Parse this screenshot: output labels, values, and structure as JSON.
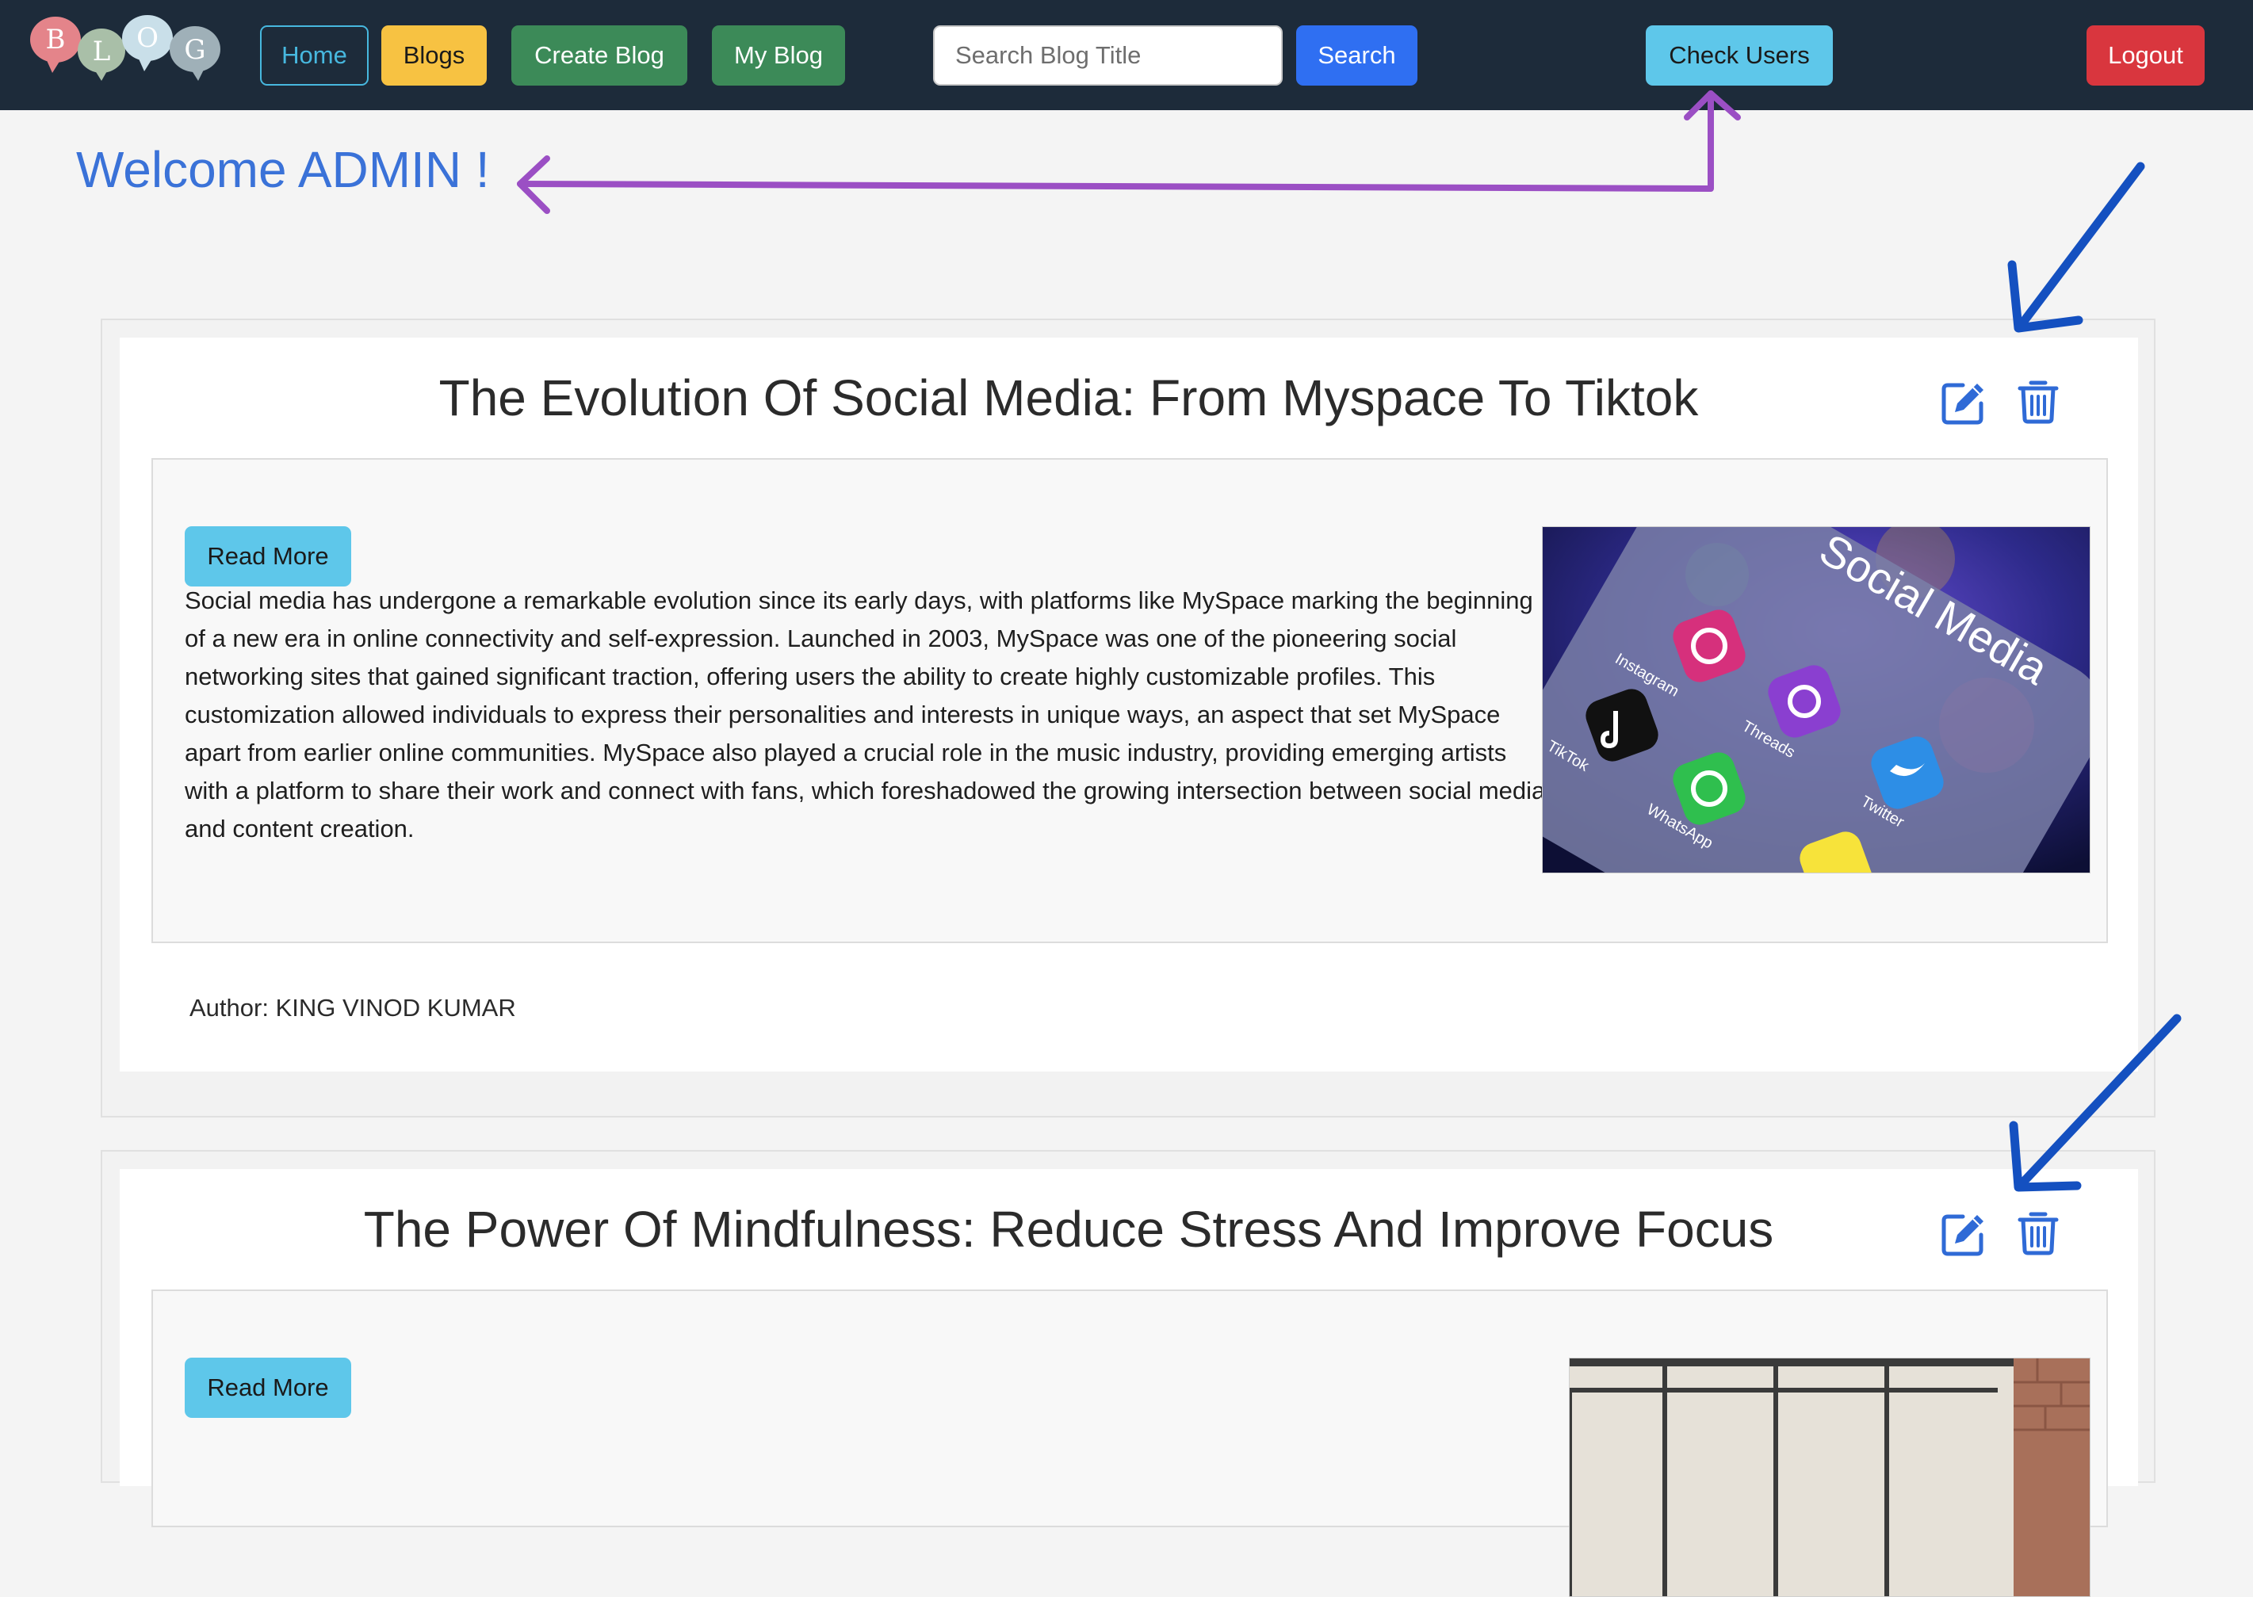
{
  "nav": {
    "logo_letters": [
      "B",
      "L",
      "O",
      "G"
    ],
    "home": "Home",
    "blogs": "Blogs",
    "create_blog": "Create Blog",
    "my_blog": "My Blog",
    "search_placeholder": "Search Blog Title",
    "search_value": "",
    "search_button": "Search",
    "check_users": "Check Users",
    "logout": "Logout"
  },
  "welcome": "Welcome ADMIN !",
  "posts": [
    {
      "title": "The Evolution Of Social Media: From Myspace To Tiktok",
      "read_more": "Read More",
      "excerpt": "Social media has undergone a remarkable evolution since its early days, with platforms like MySpace marking the beginning of a new era in online connectivity and self-expression. Launched in 2003, MySpace was one of the pioneering social networking sites that gained significant traction, offering users the ability to create highly customizable profiles. This customization allowed individuals to express their personalities and interests in unique ways, an aspect that set MySpace apart from earlier online communities. MySpace also played a crucial role in the music industry, providing emerging artists with a platform to share their work and connect with fans, which foreshadowed the growing intersection between social media and content creation.",
      "author_label": "Author:",
      "author_name": "KING VINOD KUMAR",
      "image_text": {
        "heading": "Social Media",
        "apps": [
          "Instagram",
          "TikTok",
          "Threads",
          "WhatsApp",
          "Twitter"
        ]
      }
    },
    {
      "title": "The Power Of Mindfulness: Reduce Stress And Improve Focus",
      "read_more": "Read More"
    }
  ],
  "colors": {
    "navbar": "#1d2b3a",
    "welcome": "#3a72d8",
    "annotation_purple": "#9b4fc4",
    "annotation_blue": "#1450c0",
    "action_icons": "#2f6ad6"
  },
  "icons": [
    "edit-icon",
    "trash-icon",
    "arrow-annotation"
  ]
}
